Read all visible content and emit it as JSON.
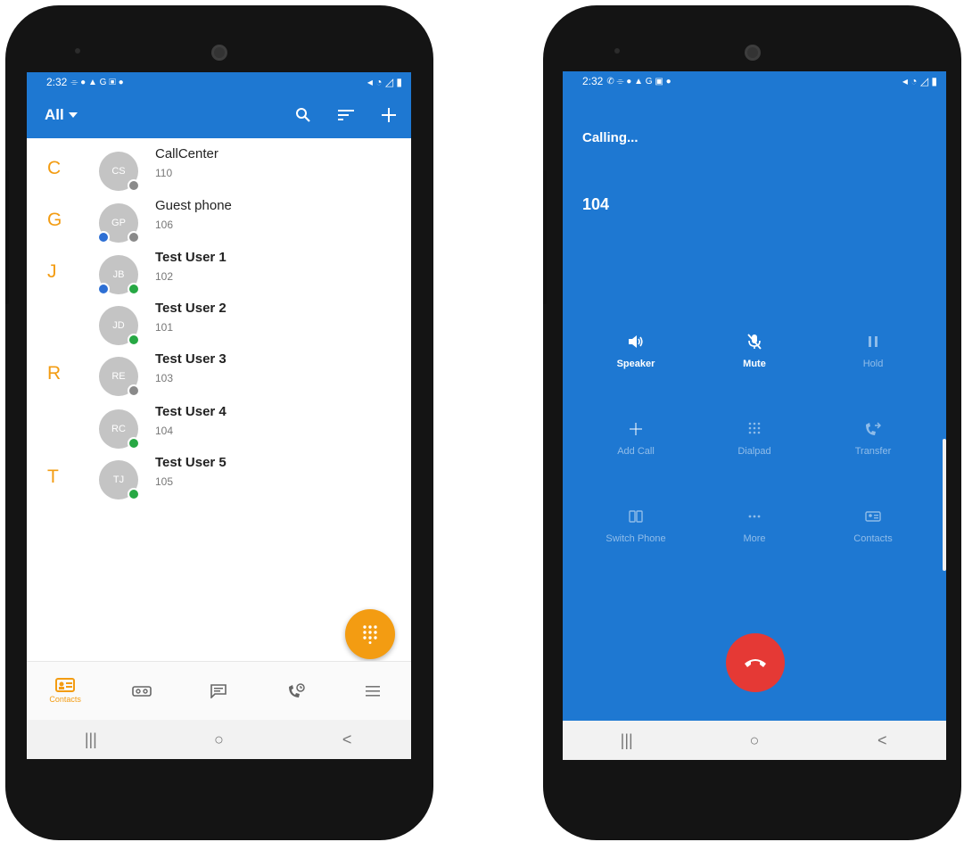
{
  "left_phone": {
    "status_bar": {
      "time": "2:32",
      "icons": "⌯ ● ▲ G ▣ ●",
      "right_icons": "◂ ◔ ◿ ▮"
    },
    "toolbar": {
      "filter_label": "All",
      "filter_icon": "chevron-down-icon",
      "search_icon": "search-icon",
      "sort_icon": "sort-icon",
      "add_icon": "plus-icon"
    },
    "contacts": [
      {
        "letter": "C",
        "initials": "CS",
        "name": "CallCenter",
        "ext": "110",
        "presence": "grey",
        "extra_presence": null
      },
      {
        "letter": "G",
        "initials": "GP",
        "name": "Guest phone",
        "ext": "106",
        "presence": "grey",
        "extra_presence": "blue"
      },
      {
        "letter": "J",
        "initials": "JB",
        "name": "Test User 1",
        "ext": "102",
        "presence": "green",
        "extra_presence": "blue"
      },
      {
        "letter": "",
        "initials": "JD",
        "name": "Test User 2",
        "ext": "101",
        "presence": "green",
        "extra_presence": null
      },
      {
        "letter": "R",
        "initials": "RE",
        "name": "Test User 3",
        "ext": "103",
        "presence": "grey",
        "extra_presence": null
      },
      {
        "letter": "",
        "initials": "RC",
        "name": "Test User 4",
        "ext": "104",
        "presence": "green",
        "extra_presence": null
      },
      {
        "letter": "T",
        "initials": "TJ",
        "name": "Test User 5",
        "ext": "105",
        "presence": "green",
        "extra_presence": null
      }
    ],
    "fab_icon": "dialpad-icon",
    "bottom_nav": [
      {
        "icon": "contacts-icon",
        "label": "Contacts"
      },
      {
        "icon": "voicemail-icon",
        "label": ""
      },
      {
        "icon": "chat-icon",
        "label": ""
      },
      {
        "icon": "call-history-icon",
        "label": ""
      },
      {
        "icon": "menu-icon",
        "label": ""
      }
    ],
    "system_nav": {
      "recents": "|||",
      "home": "○",
      "back": "<"
    }
  },
  "right_phone": {
    "status_bar": {
      "time": "2:32",
      "icons": "✆ ⌯ ● ▲ G ▣ ●",
      "right_icons": "◂ ◔ ◿ ▮"
    },
    "call_status": "Calling...",
    "number": "104",
    "controls": [
      {
        "label": "Speaker",
        "icon": "speaker-icon",
        "enabled": true
      },
      {
        "label": "Mute",
        "icon": "mute-icon",
        "enabled": true
      },
      {
        "label": "Hold",
        "icon": "pause-icon",
        "enabled": false
      },
      {
        "label": "Add Call",
        "icon": "plus-icon",
        "enabled": false
      },
      {
        "label": "Dialpad",
        "icon": "dialpad-icon",
        "enabled": false
      },
      {
        "label": "Transfer",
        "icon": "transfer-icon",
        "enabled": false
      },
      {
        "label": "Switch Phone",
        "icon": "switch-phone-icon",
        "enabled": false
      },
      {
        "label": "More",
        "icon": "more-icon",
        "enabled": false
      },
      {
        "label": "Contacts",
        "icon": "contacts-icon",
        "enabled": false
      }
    ],
    "hangup_icon": "hangup-icon",
    "system_nav": {
      "recents": "|||",
      "home": "○",
      "back": "<"
    }
  },
  "colors": {
    "brand_blue": "#1e78d2",
    "accent_orange": "#f39c12",
    "hangup_red": "#e53935",
    "presence_green": "#27a844"
  }
}
